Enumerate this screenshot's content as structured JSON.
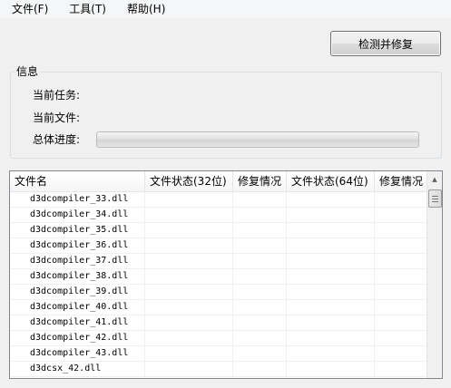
{
  "menu": {
    "file": "文件(F)",
    "tools": "工具(T)",
    "help": "帮助(H)"
  },
  "repair_button": "检测并修复",
  "info": {
    "title": "信息",
    "current_task_label": "当前任务:",
    "current_file_label": "当前文件:",
    "total_progress_label": "总体进度:",
    "progress_percent": 0
  },
  "table": {
    "columns": [
      "文件名",
      "文件状态(32位)",
      "修复情况",
      "文件状态(64位)",
      "修复情况"
    ],
    "rows": [
      "d3dcompiler_33.dll",
      "d3dcompiler_34.dll",
      "d3dcompiler_35.dll",
      "d3dcompiler_36.dll",
      "d3dcompiler_37.dll",
      "d3dcompiler_38.dll",
      "d3dcompiler_39.dll",
      "d3dcompiler_40.dll",
      "d3dcompiler_41.dll",
      "d3dcompiler_42.dll",
      "d3dcompiler_43.dll",
      "d3dcsx_42.dll"
    ]
  },
  "icons": {
    "scroll_up": "arrow-up-icon",
    "scroll_thumb": "grip-icon"
  }
}
